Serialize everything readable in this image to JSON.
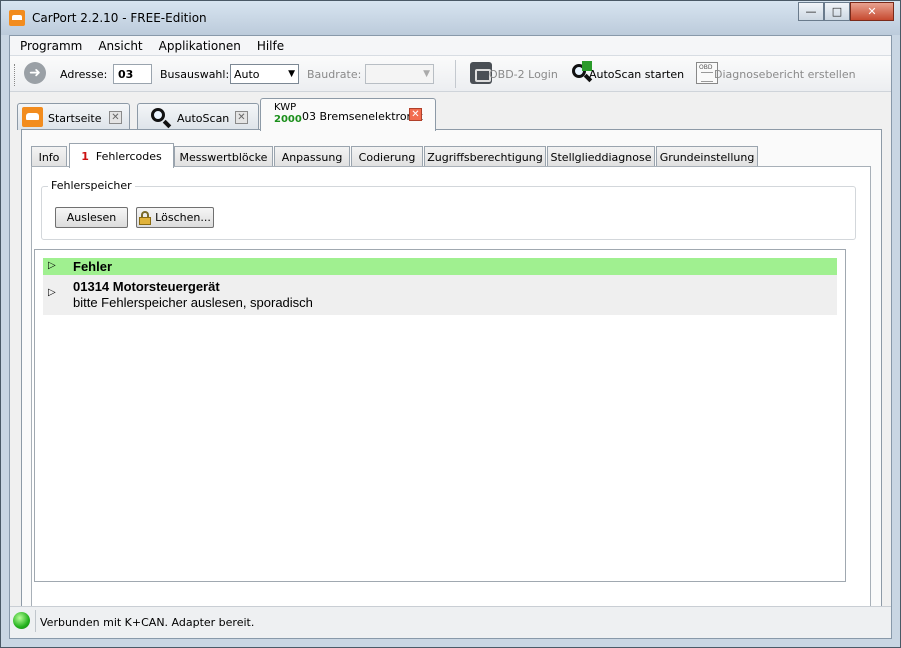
{
  "window": {
    "title": "CarPort 2.2.10  - FREE-Edition",
    "minimize_glyph": "—",
    "maximize_glyph": "□",
    "close_glyph": "✕"
  },
  "menu": {
    "items": [
      {
        "label": "Programm"
      },
      {
        "label": "Ansicht"
      },
      {
        "label": "Applikationen"
      },
      {
        "label": "Hilfe"
      }
    ]
  },
  "toolbar": {
    "nav_glyph": "➜",
    "address_label": "Adresse:",
    "address_value": "03",
    "bus_label": "Busauswahl:",
    "bus_value": "Auto",
    "baud_label": "Baudrate:",
    "baud_value": "",
    "dropdown_glyph": "▼",
    "obd_login": "OBD-2 Login",
    "autoscan_start": "AutoScan starten",
    "report": "Diagnosebericht erstellen"
  },
  "outer_tabs": [
    {
      "label": "Startseite",
      "icon": "car-icon",
      "close": "✕"
    },
    {
      "label": "AutoScan",
      "icon": "search-icon",
      "close": "✕"
    },
    {
      "protocol_top": "KWP",
      "protocol_bottom": "2000",
      "label": "03 Bremsenelektronik",
      "close": "✕",
      "active": true
    }
  ],
  "inner_tabs": [
    {
      "label": "Info"
    },
    {
      "count": "1",
      "label": "Fehlercodes",
      "active": true
    },
    {
      "label": "Messwertblöcke"
    },
    {
      "label": "Anpassung"
    },
    {
      "label": "Codierung"
    },
    {
      "label": "Zugriffsberechtigung"
    },
    {
      "label": "Stellglieddiagnose"
    },
    {
      "label": "Grundeinstellung"
    }
  ],
  "fault_memory": {
    "group_title": "Fehlerspeicher",
    "read_button": "Auslesen",
    "clear_button": "Löschen..."
  },
  "list": {
    "header": {
      "glyph": "▷",
      "title": "Fehler"
    },
    "items": [
      {
        "glyph": "▷",
        "code_title": "01314 Motorsteuergerät",
        "description": "bitte Fehlerspeicher auslesen, sporadisch"
      }
    ]
  },
  "status": {
    "text": "Verbunden mit K+CAN. Adapter bereit.",
    "led_color": "#23b11d"
  },
  "colors": {
    "header_row": "#a0f090",
    "fault_count": "#cc1111",
    "protocol_green": "#1b8f1b",
    "brand_orange": "#f28c1e"
  }
}
